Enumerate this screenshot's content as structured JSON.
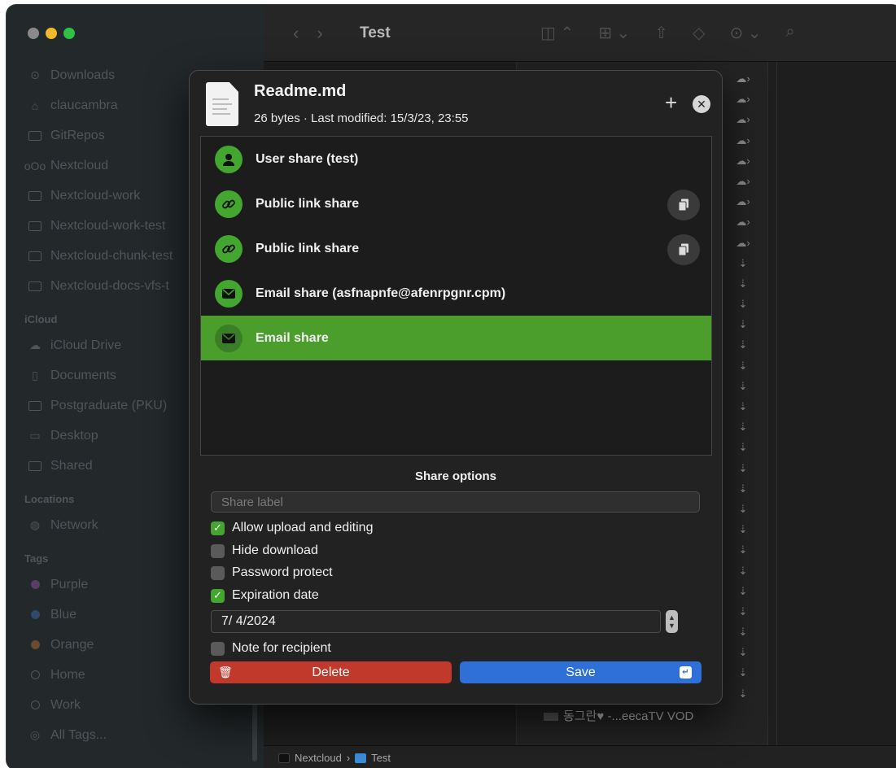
{
  "window": {
    "title": "Test",
    "traffic_lights": [
      "#8a8a8a",
      "#f4b92b",
      "#2fc145"
    ]
  },
  "sidebar": {
    "top_items": [
      {
        "label": "Downloads",
        "icon": "download-icon"
      },
      {
        "label": "claucambra",
        "icon": "home-icon"
      },
      {
        "label": "GitRepos",
        "icon": "folder-icon"
      },
      {
        "label": "Nextcloud",
        "icon": "nextcloud-icon"
      },
      {
        "label": "Nextcloud-work",
        "icon": "folder-icon"
      },
      {
        "label": "Nextcloud-work-test",
        "icon": "folder-icon"
      },
      {
        "label": "Nextcloud-chunk-test",
        "icon": "folder-icon"
      },
      {
        "label": "Nextcloud-docs-vfs-t",
        "icon": "folder-icon"
      }
    ],
    "icloud_header": "iCloud",
    "icloud_items": [
      {
        "label": "iCloud Drive",
        "icon": "cloud-icon"
      },
      {
        "label": "Documents",
        "icon": "document-icon"
      },
      {
        "label": "Postgraduate (PKU)",
        "icon": "folder-icon"
      },
      {
        "label": "Desktop",
        "icon": "desktop-icon"
      },
      {
        "label": "Shared",
        "icon": "shared-folder-icon"
      }
    ],
    "locations_header": "Locations",
    "locations_items": [
      {
        "label": "Network",
        "icon": "network-icon"
      }
    ],
    "tags_header": "Tags",
    "tags_items": [
      {
        "label": "Purple",
        "color": "#8e44ad"
      },
      {
        "label": "Blue",
        "color": "#2e6fd8"
      },
      {
        "label": "Orange",
        "color": "#e67e22"
      },
      {
        "label": "Home",
        "color": ""
      },
      {
        "label": "Work",
        "color": ""
      },
      {
        "label": "All Tags...",
        "color": ""
      }
    ]
  },
  "listing": {
    "last_file": "동그란♥ -...eecaTV VOD"
  },
  "pathbar": {
    "segments": [
      "Nextcloud",
      "Test"
    ],
    "separator": "›"
  },
  "sheet": {
    "file_name": "Readme.md",
    "file_meta": "26 bytes · Last modified: 15/3/23, 23:55",
    "add_glyph": "+",
    "close_glyph": "✕",
    "shares": [
      {
        "label": "User share (test)",
        "icon": "user-icon",
        "copy": false,
        "selected": false
      },
      {
        "label": "Public link share",
        "icon": "link-icon",
        "copy": true,
        "selected": false
      },
      {
        "label": "Public link share",
        "icon": "link-icon",
        "copy": true,
        "selected": false
      },
      {
        "label": "Email share (asfnapnfe@afenrpgnr.cpm)",
        "icon": "envelope-icon",
        "copy": false,
        "selected": false
      },
      {
        "label": "Email share",
        "icon": "envelope-icon",
        "copy": false,
        "selected": true
      }
    ],
    "options_title": "Share options",
    "share_label_placeholder": "Share label",
    "options": {
      "allow_upload": {
        "label": "Allow upload and editing",
        "checked": true
      },
      "hide_download": {
        "label": "Hide download",
        "checked": false
      },
      "password_protect": {
        "label": "Password protect",
        "checked": false
      },
      "expiration_date": {
        "label": "Expiration date",
        "checked": true
      },
      "note_for_recipient": {
        "label": "Note for recipient",
        "checked": false
      }
    },
    "expiration_value": "7/  4/2024",
    "delete_label": "Delete",
    "save_label": "Save",
    "colors": {
      "accent_green": "#43a62f",
      "selected_row": "#4b9d2c",
      "delete_red": "#c0392b",
      "save_blue": "#2f6fd8"
    }
  }
}
